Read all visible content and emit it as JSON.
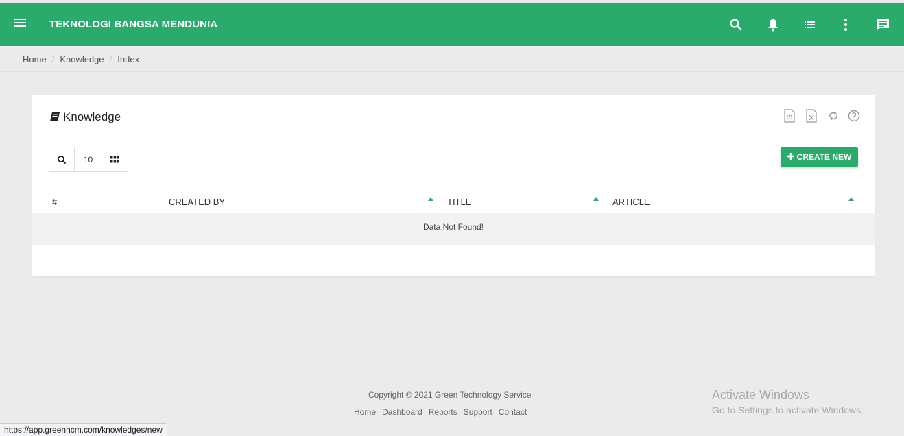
{
  "header": {
    "brand": "TEKNOLOGI BANGSA MENDUNIA",
    "accent": "#2bab6b",
    "icons": [
      "menu-icon",
      "search-icon",
      "bell-icon",
      "list-icon",
      "more-vert-icon",
      "chat-icon"
    ]
  },
  "breadcrumb": {
    "items": [
      "Home",
      "Knowledge",
      "Index"
    ],
    "separator": "/"
  },
  "card": {
    "title": "Knowledge",
    "tools": [
      "export-code-icon",
      "export-excel-icon",
      "refresh-icon",
      "help-icon"
    ],
    "page_size": "10",
    "create_label": "CREATE NEW",
    "table": {
      "columns": [
        "#",
        "CREATED BY",
        "TITLE",
        "ARTICLE"
      ],
      "empty_message": "Data Not Found!"
    }
  },
  "footer": {
    "copyright": "Copyright © 2021 Green Technology Service",
    "links": [
      "Home",
      "Dashboard",
      "Reports",
      "Support",
      "Contact"
    ]
  },
  "watermark": {
    "line1": "Activate Windows",
    "line2": "Go to Settings to activate Windows."
  },
  "status_url": "https://app.greenhcm.com/knowledges/new"
}
